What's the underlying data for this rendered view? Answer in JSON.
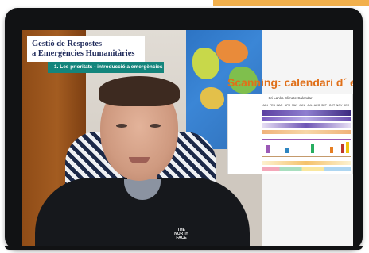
{
  "course": {
    "title_line1": "Gestió de Respostes",
    "title_line2": "a Emergències Humanitàries",
    "module_label": "1. Les prioritats - introducció a emergències"
  },
  "slide": {
    "heading": "Scanning: calendari d´ emergè",
    "calendar_title": "Sri Lanka Climate Calendar",
    "months": [
      "JAN",
      "FEB",
      "MAR",
      "APR",
      "MAY",
      "JUN",
      "JUL",
      "AUG",
      "SEP",
      "OCT",
      "NOV",
      "DEC"
    ]
  },
  "colors": {
    "accent": "#f2b04c",
    "title_text": "#1f2a5a",
    "module_bg": "#14857c",
    "heading": "#e0701a"
  }
}
